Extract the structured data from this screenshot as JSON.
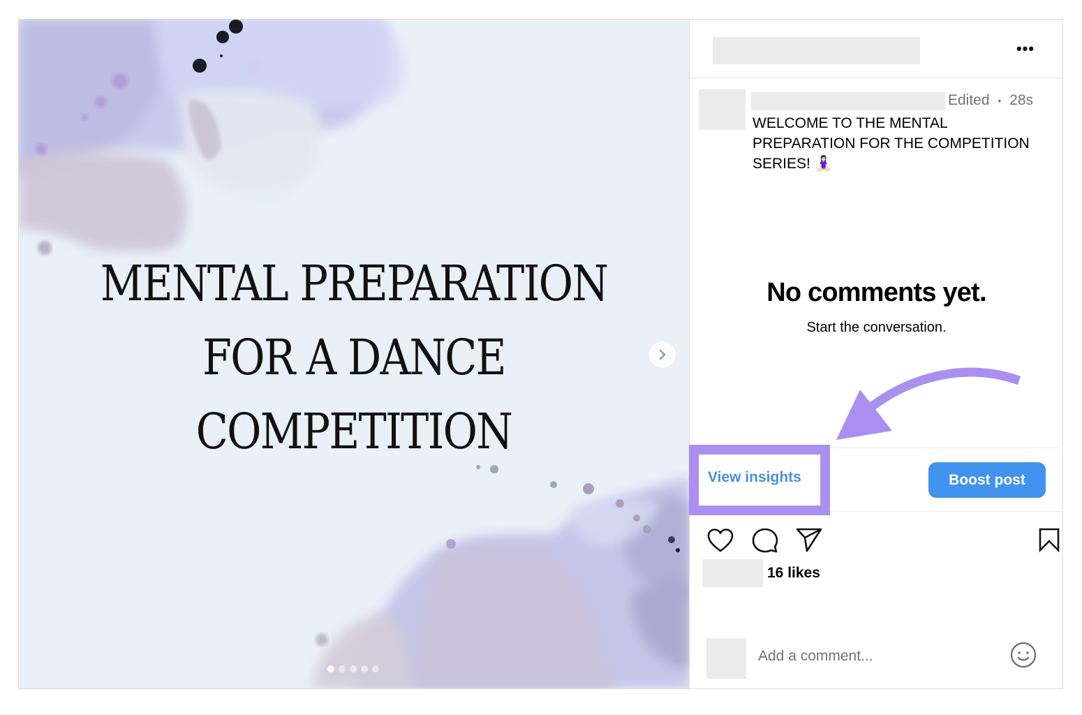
{
  "media": {
    "slide_title_lines": [
      "MENTAL PREPARATION",
      "FOR A DANCE",
      "COMPETITION"
    ],
    "carousel_total_slides": 5,
    "carousel_current_slide": 1,
    "next_icon": "chevron-right-icon"
  },
  "header": {
    "more_label": "•••",
    "more_icon": "more-horizontal-icon"
  },
  "caption": {
    "edited_label": "Edited",
    "separator": "•",
    "time": "28s",
    "text": "WELCOME TO THE MENTAL PREPARATION FOR THE COMPETITION SERIES! 🧘🏻‍♀️"
  },
  "comments": {
    "empty_title": "No comments yet.",
    "empty_subtitle": "Start the conversation."
  },
  "actions": {
    "insights_label": "View insights",
    "boost_label": "Boost post",
    "icons": [
      "heart-icon",
      "comment-icon",
      "share-icon",
      "bookmark-icon"
    ]
  },
  "likes": {
    "count_label": "16 likes"
  },
  "comment_input": {
    "placeholder": "Add a comment...",
    "value": "",
    "emoji_icon": "smiley-icon"
  },
  "colors": {
    "annotation_purple": "#ab8ff0",
    "link_blue": "#4a8fdc",
    "boost_blue": "#4193ed",
    "slide_background": "#eaf0f8"
  }
}
